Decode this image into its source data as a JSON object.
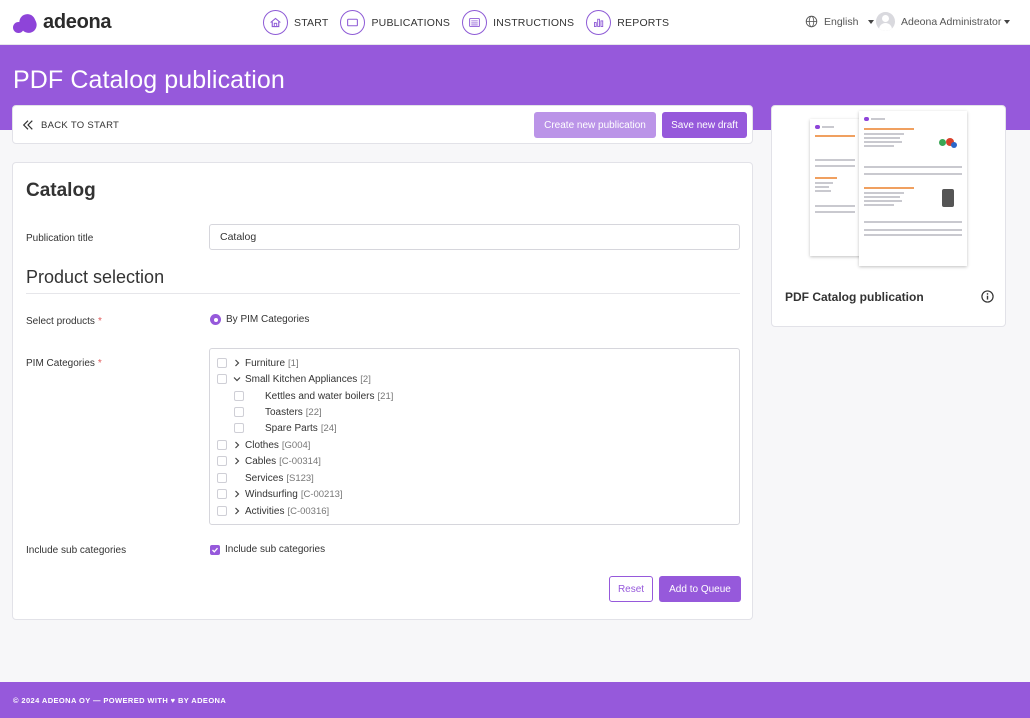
{
  "brand": {
    "name": "adeona",
    "color": "#9659db"
  },
  "nav": [
    {
      "label": "START",
      "icon": "home-icon"
    },
    {
      "label": "PUBLICATIONS",
      "icon": "tablet-icon"
    },
    {
      "label": "INSTRUCTIONS",
      "icon": "list-icon"
    },
    {
      "label": "REPORTS",
      "icon": "bar-chart-icon"
    }
  ],
  "language": "English",
  "user": "Adeona Administrator",
  "page_title": "PDF Catalog publication",
  "toolbar": {
    "back_label": "BACK TO START",
    "create_label": "Create new publication",
    "draft_label": "Save new draft"
  },
  "form": {
    "heading": "Catalog",
    "publication_title_label": "Publication title",
    "publication_title_value": "Catalog",
    "section_title": "Product selection",
    "select_products_label": "Select products",
    "select_products_option": "By PIM Categories",
    "pim_categories_label": "PIM Categories",
    "categories": [
      {
        "name": "Furniture",
        "code": "[1]",
        "expandable": true,
        "expanded": false,
        "level": 0
      },
      {
        "name": "Small Kitchen Appliances",
        "code": "[2]",
        "expandable": true,
        "expanded": true,
        "level": 0
      },
      {
        "name": "Kettles and water boilers",
        "code": "[21]",
        "expandable": false,
        "level": 1
      },
      {
        "name": "Toasters",
        "code": "[22]",
        "expandable": false,
        "level": 1
      },
      {
        "name": "Spare Parts",
        "code": "[24]",
        "expandable": false,
        "level": 1
      },
      {
        "name": "Clothes",
        "code": "[G004]",
        "expandable": true,
        "expanded": false,
        "level": 0
      },
      {
        "name": "Cables",
        "code": "[C-00314]",
        "expandable": true,
        "expanded": false,
        "level": 0
      },
      {
        "name": "Services",
        "code": "[S123]",
        "expandable": false,
        "level": 0
      },
      {
        "name": "Windsurfing",
        "code": "[C-00213]",
        "expandable": true,
        "expanded": false,
        "level": 0
      },
      {
        "name": "Activities",
        "code": "[C-00316]",
        "expandable": true,
        "expanded": false,
        "level": 0
      }
    ],
    "include_sub_label": "Include sub categories",
    "include_sub_checkbox_label": "Include sub categories",
    "reset_label": "Reset",
    "queue_label": "Add to Queue"
  },
  "preview": {
    "title": "PDF Catalog publication"
  },
  "footer": "© 2024 ADEONA OY — POWERED WITH ♥ BY ADEONA"
}
